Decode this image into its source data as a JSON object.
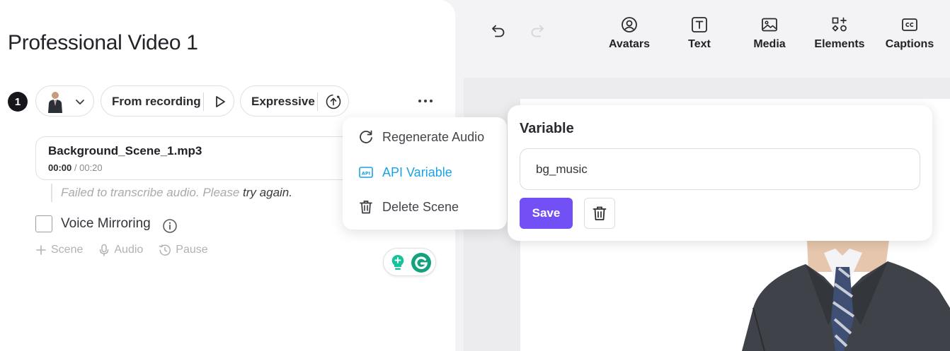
{
  "page_title": "Professional Video 1",
  "scene": {
    "number": "1",
    "voice_source": "From recording",
    "voice_style": "Expressive"
  },
  "audio": {
    "file_name": "Background_Scene_1.mp3",
    "current_time": "00:00",
    "separator": " / ",
    "duration": "00:20"
  },
  "transcription": {
    "message": "Failed to transcribe audio. Please ",
    "retry_link": "try again."
  },
  "voice_mirroring": {
    "label": "Voice Mirroring",
    "checked": false
  },
  "add_actions": [
    {
      "label": "Scene",
      "icon": "plus-icon"
    },
    {
      "label": "Audio",
      "icon": "microphone-icon"
    },
    {
      "label": "Pause",
      "icon": "pause-clock-icon"
    }
  ],
  "context_menu": {
    "items": [
      {
        "label": "Regenerate Audio",
        "icon": "regenerate-icon"
      },
      {
        "label": "API Variable",
        "icon": "api-icon",
        "active": true
      },
      {
        "label": "Delete Scene",
        "icon": "trash-icon"
      }
    ]
  },
  "variable_popover": {
    "title": "Variable",
    "value": "bg_music",
    "save_label": "Save"
  },
  "toolbar": {
    "tools": [
      {
        "label": "Avatars",
        "icon": "avatar-icon"
      },
      {
        "label": "Text",
        "icon": "text-icon"
      },
      {
        "label": "Media",
        "icon": "media-icon"
      },
      {
        "label": "Elements",
        "icon": "elements-icon"
      },
      {
        "label": "Captions",
        "icon": "captions-icon"
      }
    ]
  },
  "colors": {
    "accent": "#7350f5",
    "link_active": "#1aa3e6",
    "grammarly_green": "#15c39a"
  }
}
